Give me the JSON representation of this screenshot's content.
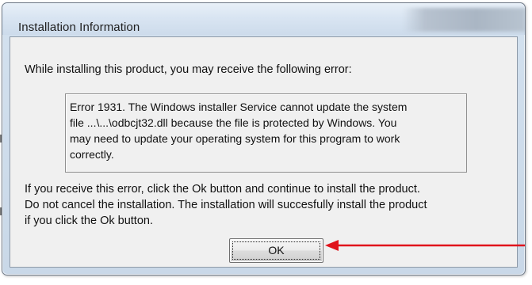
{
  "window": {
    "title": "Installation Information"
  },
  "dialog": {
    "intro": "While installing this product, you may receive the following error:",
    "error_lines": [
      "Error 1931.  The Windows installer Service cannot update the system",
      "file ...\\...\\odbcjt32.dll because the file is protected by Windows.  You",
      "may need to update your operating system for this program to work",
      "correctly."
    ],
    "info_lines": [
      "If you receive this error, click the Ok button and continue to install the product.",
      "Do not cancel the installation.  The installation will succesfully install the product",
      "if you click the Ok button."
    ],
    "ok_label": "OK"
  },
  "annotation": {
    "arrow_color": "#e0141c",
    "arrow_icon": "arrow-left-icon"
  }
}
